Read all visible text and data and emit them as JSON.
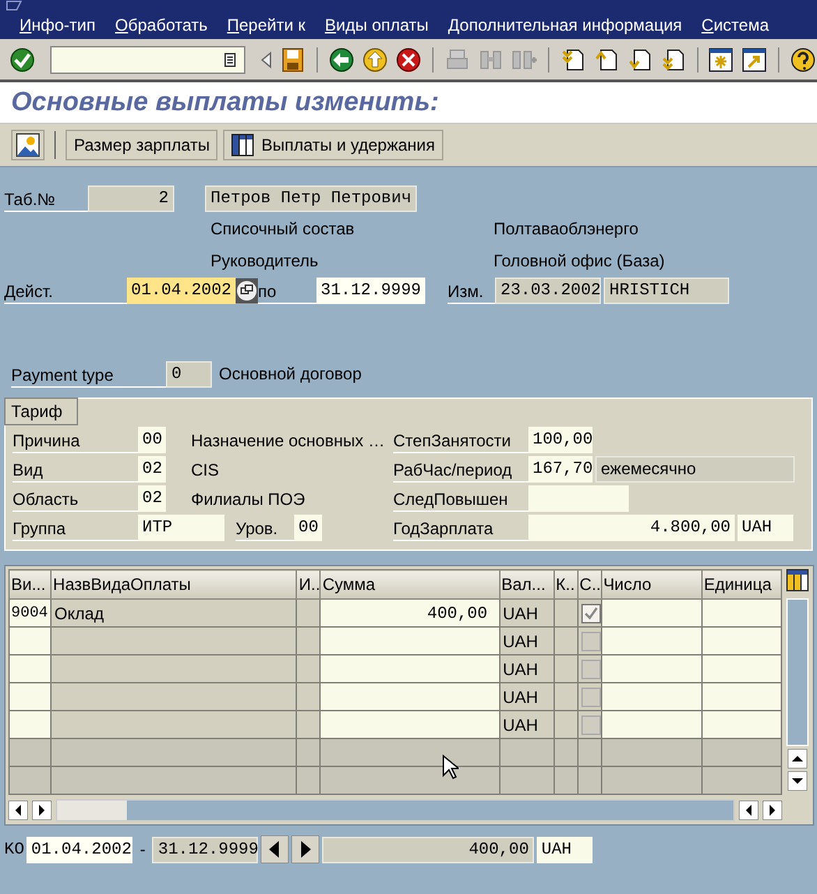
{
  "menu": [
    {
      "label": "Инфо-тип"
    },
    {
      "label": "Обработать"
    },
    {
      "label": "Перейти к"
    },
    {
      "label": "Виды оплаты"
    },
    {
      "label": "Дополнительная информация"
    },
    {
      "label": "Система"
    }
  ],
  "title": "Основные выплаты изменить:",
  "app_buttons": [
    {
      "label": "Размер зарплаты"
    },
    {
      "label": "Выплаты и удержания"
    }
  ],
  "header": {
    "pernr_label": "Таб.№",
    "pernr": "2",
    "name": "Петров Петр Петрович",
    "texts": [
      {
        "left": "Списочный состав",
        "right": "Полтаваоблэнерго"
      },
      {
        "left": "Руководитель",
        "right": "Головной офис (База)"
      }
    ],
    "valid_label": "Дейст.",
    "from": {
      "value": "01.04.2002",
      "focused": true
    },
    "to_label": "по",
    "to": {
      "value": "31.12.9999",
      "focused": false
    },
    "changed_label": "Изм.",
    "changed_date": "23.03.2002",
    "changed_by": "HRISTICH"
  },
  "payment_type": {
    "label": "Payment type",
    "value": "0",
    "text": "Основной договор"
  },
  "tariff": {
    "title": "Тариф",
    "rows": [
      {
        "left": {
          "label": "Причина",
          "value": "00",
          "text": "Назначение основных …"
        },
        "right": {
          "label": "СтепЗанятости",
          "value": "100,00",
          "kind": "number"
        }
      },
      {
        "left": {
          "label": "Вид",
          "value": "02",
          "text": "CIS"
        },
        "right": {
          "label": "РабЧас/период",
          "value": "167,70",
          "kind": "number",
          "unit": {
            "text": "ежемесячно",
            "disabled": true
          }
        }
      },
      {
        "left": {
          "label": "Область",
          "value": "02",
          "text": "Филиалы ПОЭ"
        },
        "right": {
          "label": "СледПовышен",
          "kind": "date"
        }
      },
      {
        "left": {
          "label": "Группа",
          "value": "ИТР",
          "kind": "wide",
          "sub_label": "Уров.",
          "sub_value": "00"
        },
        "right": {
          "label": "ГодЗарплата",
          "value": "4.800,00",
          "kind": "amount",
          "unit": {
            "text": "UAH",
            "disabled": false
          }
        }
      }
    ]
  },
  "table": {
    "columns": [
      {
        "label": "Ви...",
        "editable": true
      },
      {
        "label": "НазвВидаОплаты",
        "editable": false
      },
      {
        "label": "И..",
        "editable": false
      },
      {
        "label": "Сумма",
        "editable": true
      },
      {
        "label": "Вал...",
        "editable": false
      },
      {
        "label": "К..",
        "editable": false
      },
      {
        "label": "С..",
        "editable": false
      },
      {
        "label": "Число",
        "editable": true
      },
      {
        "label": "Единица",
        "editable": true
      }
    ],
    "rows": [
      {
        "disabled": false,
        "checked": true,
        "wagetype": "9004",
        "name": "Оклад",
        "amount": "400,00",
        "currency": "UAH"
      },
      {
        "disabled": false,
        "checked": false,
        "currency": "UAH"
      },
      {
        "disabled": false,
        "checked": false,
        "currency": "UAH"
      },
      {
        "disabled": false,
        "checked": false,
        "currency": "UAH"
      },
      {
        "disabled": false,
        "checked": false,
        "currency": "UAH"
      },
      {
        "disabled": true
      },
      {
        "disabled": true
      }
    ]
  },
  "footer": {
    "label": "KO",
    "from": "01.04.2002",
    "separator": "-",
    "to": "31.12.9999",
    "amount": "400,00",
    "currency": "UAH"
  }
}
